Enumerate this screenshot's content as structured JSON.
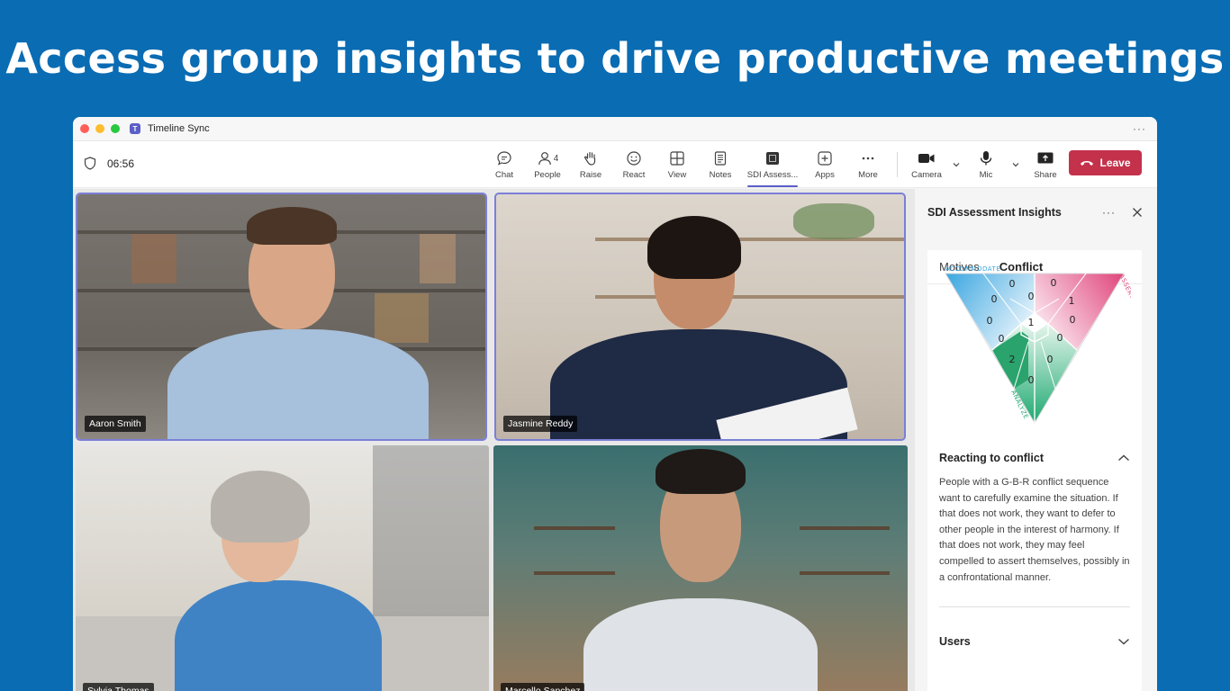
{
  "headline": "Access group insights to drive productive meetings",
  "window": {
    "title": "Timeline Sync",
    "more": "···"
  },
  "toolbar": {
    "timer": "06:56",
    "tools": [
      {
        "label": "Chat"
      },
      {
        "label": "People",
        "count": "4"
      },
      {
        "label": "Raise"
      },
      {
        "label": "React"
      },
      {
        "label": "View"
      },
      {
        "label": "Notes"
      },
      {
        "label": "SDI Assess..."
      },
      {
        "label": "Apps"
      },
      {
        "label": "More"
      }
    ],
    "camera": "Camera",
    "mic": "Mic",
    "share": "Share",
    "leave": "Leave"
  },
  "participants": [
    {
      "name": "Aaron Smith"
    },
    {
      "name": "Jasmine Reddy"
    },
    {
      "name": "Sylvia Thomas"
    },
    {
      "name": "Marcello Sanchez"
    }
  ],
  "panel": {
    "title": "SDI Assessment Insights",
    "more": "···",
    "tabs": [
      "Motives",
      "Conflict"
    ],
    "active_tab": "Conflict",
    "triangle": {
      "labels": {
        "accommodate": "ACCOMMODATE",
        "assert": "ASSERT",
        "analyze": "ANALYZE"
      },
      "colors": {
        "accommodate": "#3aa6e0",
        "assert": "#e0457b",
        "analyze": "#1fa971"
      },
      "values": [
        "0",
        "0",
        "0",
        "1",
        "0",
        "0",
        "0",
        "0",
        "0",
        "0",
        "1",
        "0",
        "0",
        "2",
        "0",
        "0"
      ]
    },
    "section_title": "Reacting to conflict",
    "description": "People with a G-B-R conflict sequence want to carefully examine the situation. If that does not work, they want to defer to other people in the interest of harmony. If that does not work, they may feel compelled to assert themselves, possibly in a confrontational manner.",
    "users_label": "Users"
  }
}
